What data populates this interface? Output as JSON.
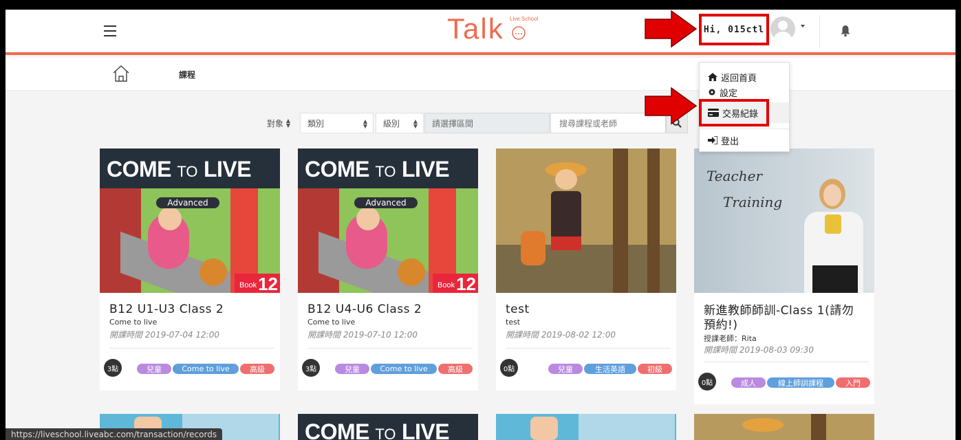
{
  "header": {
    "logo_text": "Talk",
    "logo_sub": "Live School",
    "greeting": "Hi, 015ctl"
  },
  "breadcrumb": {
    "current": "課程"
  },
  "filters": {
    "target": "對象",
    "category": "類別",
    "level": "級別",
    "date_range_placeholder": "請選擇區間",
    "search_placeholder": "搜尋課程或老師"
  },
  "user_menu": {
    "items": [
      {
        "label": "返回首頁",
        "icon": "home-icon"
      },
      {
        "label": "設定",
        "icon": "gear-icon"
      },
      {
        "label": "交易紀錄",
        "icon": "credit-card-icon"
      },
      {
        "label": "登出",
        "icon": "sign-out-icon"
      }
    ]
  },
  "poster": {
    "line_big1": "COME",
    "line_small": "TO",
    "line_big2": "LIVE",
    "badge": "Advanced",
    "book_word": "Book",
    "book_num": "12",
    "teacher_line1": "Teacher",
    "teacher_line2": "Training"
  },
  "courses": [
    {
      "title": "B12 U1-U3 Class 2",
      "subtitle": "Come to live",
      "date_label": "開課時間",
      "date": "2019-07-04 12:00",
      "points": "3點",
      "tags": [
        "兒童",
        "Come to live",
        "高級"
      ]
    },
    {
      "title": "B12 U4-U6 Class 2",
      "subtitle": "Come to live",
      "date_label": "開課時間",
      "date": "2019-07-10 12:00",
      "points": "3點",
      "tags": [
        "兒童",
        "Come to live",
        "高級"
      ]
    },
    {
      "title": "test",
      "subtitle": "test",
      "date_label": "開課時間",
      "date": "2019-08-02 12:00",
      "points": "0點",
      "tags": [
        "兒童",
        "生活英語",
        "初級"
      ]
    },
    {
      "title_line1": "新進教師師訓-Class 1(請勿",
      "title_line2": "預約!)",
      "subtitle": "授課老師：Rita",
      "date_label": "開課時間",
      "date": "2019-08-03 09:30",
      "points": "0點",
      "tags": [
        "成人",
        "線上師訓課程",
        "入門"
      ]
    }
  ],
  "status_url": "https://liveschool.liveabc.com/transaction/records",
  "colors": {
    "accent": "#ee6b4d",
    "highlight": "#e00000",
    "tag_purple": "#b98ae0",
    "tag_blue": "#5f9fdc",
    "tag_red": "#ef6f6f"
  }
}
